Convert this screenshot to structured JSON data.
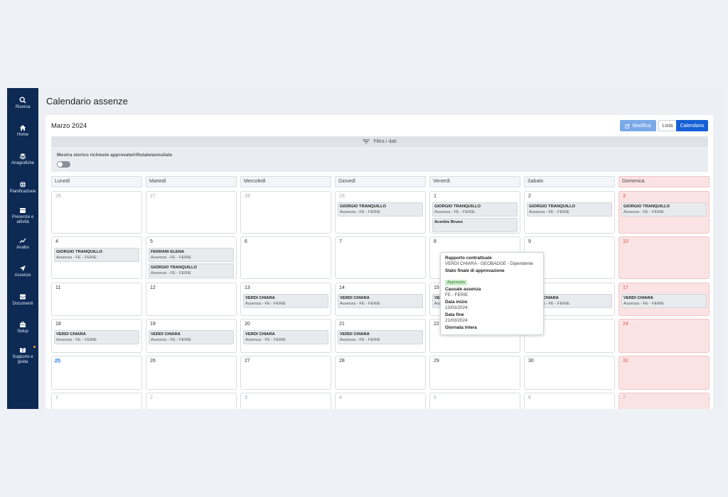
{
  "sidebar": {
    "items": [
      {
        "label": "Ricerca",
        "icon": "search-icon"
      },
      {
        "label": "Home",
        "icon": "home-icon"
      },
      {
        "label": "Anagrafiche",
        "icon": "layers-icon"
      },
      {
        "label": "Pianificazione",
        "icon": "globe-icon"
      },
      {
        "label": "Presenze e attività",
        "icon": "calendar-icon"
      },
      {
        "label": "Analisi",
        "icon": "chart-icon"
      },
      {
        "label": "Assenze",
        "icon": "send-icon"
      },
      {
        "label": "Documenti",
        "icon": "inbox-icon"
      },
      {
        "label": "Setup",
        "icon": "briefcase-icon"
      },
      {
        "label": "Supporto e guida",
        "icon": "book-icon"
      }
    ]
  },
  "page": {
    "title": "Calendario assenze"
  },
  "toolbar": {
    "month": "Marzo 2024",
    "modifica_label": "Modifica",
    "lista_label": "Lista",
    "calendario_label": "Calendario",
    "filter_label": "Filtra i dati",
    "history_label": "Mostra storico richieste approvate/rifiutate/annullate"
  },
  "calendar": {
    "weekdays": [
      "Lunedì",
      "Martedì",
      "Mercoledì",
      "Giovedì",
      "Venerdì",
      "Sabato",
      "Domenica"
    ],
    "weeks": [
      [
        {
          "day": "26",
          "muted": true,
          "events": []
        },
        {
          "day": "27",
          "muted": true,
          "events": []
        },
        {
          "day": "28",
          "muted": true,
          "events": []
        },
        {
          "day": "29",
          "muted": true,
          "events": [
            {
              "name": "GIORGIO TRANQUILLO",
              "detail": "Assenza - FE - FERIE"
            }
          ]
        },
        {
          "day": "1",
          "events": [
            {
              "name": "GIORGIO TRANQUILLO",
              "detail": "Assenza - FE - FERIE"
            },
            {
              "name": "Acerbis Bruno",
              "detail": ""
            }
          ]
        },
        {
          "day": "2",
          "events": [
            {
              "name": "GIORGIO TRANQUILLO",
              "detail": "Assenza - FE - FERIE"
            }
          ]
        },
        {
          "day": "3",
          "events": [
            {
              "name": "GIORGIO TRANQUILLO",
              "detail": "Assenza - FE - FERIE"
            }
          ]
        }
      ],
      [
        {
          "day": "4",
          "events": [
            {
              "name": "GIORGIO TRANQUILLO",
              "detail": "Assenza - FE - FERIE"
            }
          ]
        },
        {
          "day": "5",
          "events": [
            {
              "name": "FERRARI ELENA",
              "detail": "Assenza - FE - FERIE"
            },
            {
              "name": "GIORGIO TRANQUILLO",
              "detail": "Assenza - FE - FERIE"
            }
          ]
        },
        {
          "day": "6",
          "events": []
        },
        {
          "day": "7",
          "events": []
        },
        {
          "day": "8",
          "events": []
        },
        {
          "day": "9",
          "events": []
        },
        {
          "day": "10",
          "events": []
        }
      ],
      [
        {
          "day": "11",
          "events": []
        },
        {
          "day": "12",
          "events": []
        },
        {
          "day": "13",
          "events": [
            {
              "name": "VERDI CHIARA",
              "detail": "Assenza - FE - FERIE"
            }
          ]
        },
        {
          "day": "14",
          "events": [
            {
              "name": "VERDI CHIARA",
              "detail": "Assenza - FE - FERIE"
            }
          ]
        },
        {
          "day": "15",
          "events": [
            {
              "name": "VERDI CHIARA",
              "detail": "Assenza - FE - FERIE"
            }
          ]
        },
        {
          "day": "16",
          "events": [
            {
              "name": "VERDI CHIARA",
              "detail": "Assenza - FE - FERIE"
            }
          ]
        },
        {
          "day": "17",
          "events": [
            {
              "name": "VERDI CHIARA",
              "detail": "Assenza - FE - FERIE"
            }
          ]
        }
      ],
      [
        {
          "day": "18",
          "events": [
            {
              "name": "VERDI CHIARA",
              "detail": "Assenza - FE - FERIE"
            }
          ]
        },
        {
          "day": "19",
          "events": [
            {
              "name": "VERDI CHIARA",
              "detail": "Assenza - FE - FERIE"
            }
          ]
        },
        {
          "day": "20",
          "events": [
            {
              "name": "VERDI CHIARA",
              "detail": "Assenza - FE - FERIE"
            }
          ]
        },
        {
          "day": "21",
          "events": [
            {
              "name": "VERDI CHIARA",
              "detail": "Assenza - FE - FERIE"
            }
          ]
        },
        {
          "day": "22",
          "events": []
        },
        {
          "day": "23",
          "events": []
        },
        {
          "day": "24",
          "events": []
        }
      ],
      [
        {
          "day": "25",
          "today": true,
          "events": []
        },
        {
          "day": "26",
          "events": []
        },
        {
          "day": "27",
          "events": []
        },
        {
          "day": "28",
          "events": []
        },
        {
          "day": "29",
          "events": []
        },
        {
          "day": "30",
          "events": []
        },
        {
          "day": "31",
          "events": []
        }
      ],
      [
        {
          "day": "1",
          "muted": true,
          "events": []
        },
        {
          "day": "2",
          "muted": true,
          "events": []
        },
        {
          "day": "3",
          "muted": true,
          "events": []
        },
        {
          "day": "4",
          "muted": true,
          "events": []
        },
        {
          "day": "5",
          "muted": true,
          "events": []
        },
        {
          "day": "6",
          "muted": true,
          "events": []
        },
        {
          "day": "7",
          "muted": true,
          "events": []
        }
      ]
    ]
  },
  "tooltip": {
    "rapporto_label": "Rapporto contrattuale",
    "rapporto_value": "VERDI CHIARA - GEOBADGE - Dipendente",
    "stato_label": "Stato finale di approvazione",
    "stato_value": "Approvata",
    "causale_label": "Causale assenza",
    "causale_value": "FE - FERIE",
    "inizio_label": "Data inizio",
    "inizio_value": "13/03/2024",
    "fine_label": "Data fine",
    "fine_value": "21/03/2024",
    "giornata_label": "Giornata intera"
  },
  "colors": {
    "sidebar": "#0d2a55",
    "primary": "#1660d6",
    "sunday": "#fbe3e3",
    "approved": "#cdeccb"
  }
}
